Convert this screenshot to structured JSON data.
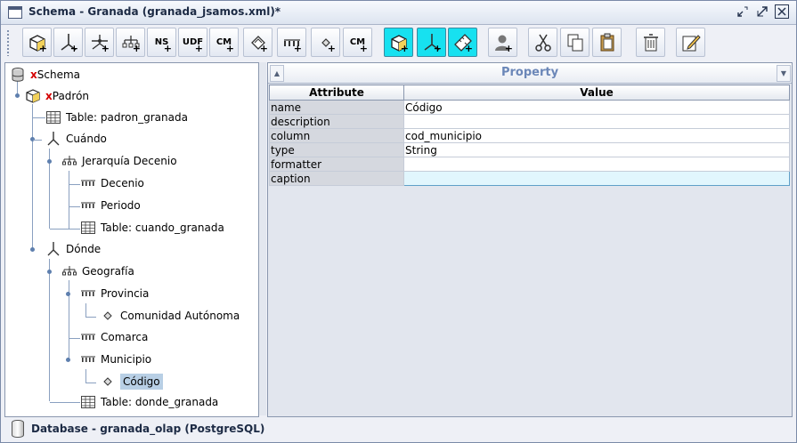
{
  "window": {
    "title": "Schema - Granada (granada_jsamos.xml)*",
    "controls": [
      "minimize-icon",
      "maximize-icon",
      "close-icon"
    ]
  },
  "toolbar": {
    "buttons": [
      {
        "id": "add-cube",
        "icon": "cube-add-icon"
      },
      {
        "id": "add-dimension",
        "icon": "dimension-add-icon"
      },
      {
        "id": "add-dimension-usage",
        "icon": "dimension-usage-add-icon"
      },
      {
        "id": "add-hierarchy",
        "icon": "hierarchy-add-icon"
      },
      {
        "id": "add-named-set",
        "label": "NS",
        "icon": "named-set-add-icon"
      },
      {
        "id": "add-udf",
        "label": "UDF",
        "icon": "udf-add-icon"
      },
      {
        "id": "add-calculated-member",
        "label": "CM",
        "icon": "calculated-member-add-icon"
      },
      {
        "id": "add-measure",
        "icon": "measure-add-icon"
      },
      {
        "id": "add-level",
        "icon": "level-add-icon"
      },
      {
        "id": "add-property",
        "icon": "property-add-icon"
      },
      {
        "id": "add-calculated-member-2",
        "label": "CM",
        "icon": "calculated-member-add-icon"
      },
      {
        "id": "add-virtual-cube",
        "icon": "virtual-cube-add-icon",
        "accent": "#17e1f0"
      },
      {
        "id": "add-virtual-dimension",
        "icon": "virtual-dimension-add-icon",
        "accent": "#17e1f0"
      },
      {
        "id": "add-virtual-measure",
        "icon": "virtual-measure-add-icon",
        "accent": "#17e1f0"
      },
      {
        "id": "add-role",
        "icon": "role-add-icon"
      },
      {
        "id": "cut",
        "icon": "scissors-icon"
      },
      {
        "id": "copy",
        "icon": "copy-icon"
      },
      {
        "id": "paste",
        "icon": "paste-icon"
      },
      {
        "id": "delete",
        "icon": "trash-icon"
      },
      {
        "id": "edit",
        "icon": "edit-icon"
      }
    ]
  },
  "tree": {
    "nodes": [
      {
        "prefix": "x",
        "label": "Schema",
        "icon": "database-icon"
      },
      {
        "prefix": "x",
        "label": "Padrón",
        "icon": "cube-icon"
      },
      {
        "label": "Table: padron_granada",
        "icon": "table-icon"
      },
      {
        "label": "Cuándo",
        "icon": "dimension-icon"
      },
      {
        "label": "Jerarquía Decenio",
        "icon": "hierarchy-icon"
      },
      {
        "label": "Decenio",
        "icon": "level-icon"
      },
      {
        "label": "Periodo",
        "icon": "level-icon"
      },
      {
        "label": "Table: cuando_granada",
        "icon": "table-icon"
      },
      {
        "label": "Dónde",
        "icon": "dimension-icon"
      },
      {
        "label": "Geografía",
        "icon": "hierarchy-icon"
      },
      {
        "label": "Provincia",
        "icon": "level-icon"
      },
      {
        "label": "Comunidad Autónoma",
        "icon": "property-icon"
      },
      {
        "label": "Comarca",
        "icon": "level-icon"
      },
      {
        "label": "Municipio",
        "icon": "level-icon"
      },
      {
        "label": "Código",
        "icon": "property-icon",
        "selected": true
      },
      {
        "label": "Table: donde_granada",
        "icon": "table-icon"
      }
    ]
  },
  "property_panel": {
    "title": "Property",
    "columns": [
      "Attribute",
      "Value"
    ],
    "rows": [
      {
        "attribute": "name",
        "value": "Código"
      },
      {
        "attribute": "description",
        "value": ""
      },
      {
        "attribute": "column",
        "value": "cod_municipio"
      },
      {
        "attribute": "type",
        "value": "String"
      },
      {
        "attribute": "formatter",
        "value": ""
      },
      {
        "attribute": "caption",
        "value": "",
        "editing": true
      }
    ]
  },
  "status": {
    "text": "Database - granada_olap (PostgreSQL)"
  },
  "colors": {
    "accent_cyan": "#17e1f0",
    "tree_selection": "#b8cfe5",
    "prefix_red": "#d40000",
    "property_title": "#6b87b8"
  }
}
